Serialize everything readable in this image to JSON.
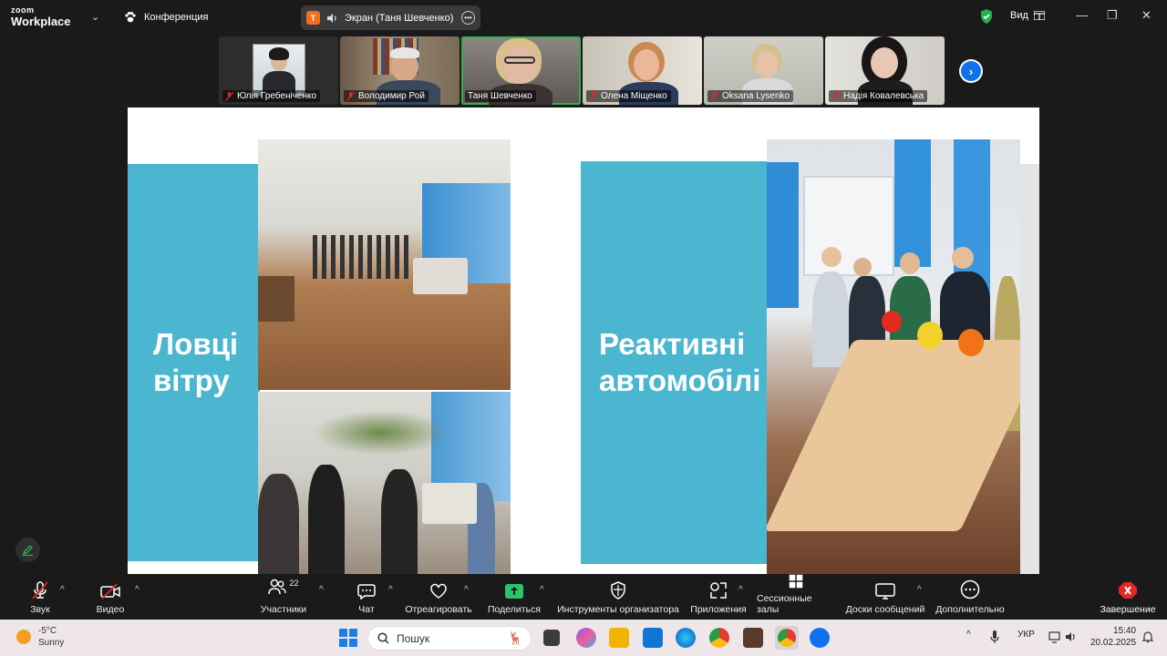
{
  "titlebar": {
    "logo_top": "zoom",
    "logo_bottom": "Workplace",
    "meeting_label": "Конференция",
    "share_badge_letter": "T",
    "share_label": "Экран (Таня Шевченко)",
    "view_label": "Вид"
  },
  "participants": [
    {
      "name": "Юлія Гребеніченко",
      "muted": true
    },
    {
      "name": "Володимир Рой",
      "muted": true
    },
    {
      "name": "Таня Шевченко",
      "muted": false,
      "active": true
    },
    {
      "name": "Олена Міщенко",
      "muted": true
    },
    {
      "name": "Oksana Lysenko",
      "muted": true
    },
    {
      "name": "Надія Ковалевська",
      "muted": true
    }
  ],
  "slide": {
    "left_title_line1": "Ловці",
    "left_title_line2": "вітру",
    "right_title_line1": "Реактивні",
    "right_title_line2": "автомобілі"
  },
  "toolbar": {
    "audio": "Звук",
    "video": "Видео",
    "participants": "Участники",
    "participants_count": "22",
    "chat": "Чат",
    "react": "Отреагировать",
    "share": "Поделиться",
    "host_tools": "Инструменты организатора",
    "apps": "Приложения",
    "breakout": "Сессионные залы",
    "whiteboards": "Доски сообщений",
    "more": "Дополнительно",
    "end": "Завершение"
  },
  "taskbar": {
    "temperature": "-5°C",
    "weather": "Sunny",
    "search_placeholder": "Пошук",
    "language": "УКР",
    "time": "15:40",
    "date": "20.02.2025"
  },
  "colors": {
    "zoom_blue": "#0e72ed",
    "active_green": "#2fb24c",
    "slide_teal": "#4bb6d0",
    "share_green": "#2cc36b",
    "end_red": "#e02828"
  }
}
